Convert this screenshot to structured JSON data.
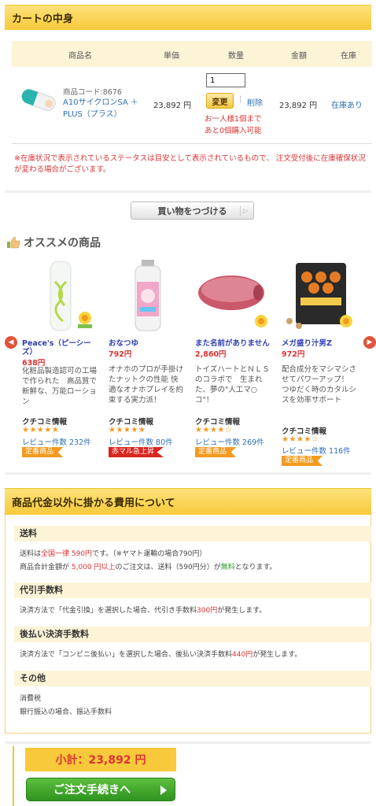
{
  "cart": {
    "title": "カートの中身",
    "columns": [
      "商品名",
      "単価",
      "数量",
      "金額",
      "在庫"
    ],
    "item": {
      "code": "商品コード:8676",
      "name": "A10サイクロンSA ＋ PLUS（プラス）",
      "price": "23,892 円",
      "quantity": "1",
      "change_label": "変更",
      "delete_label": "削除",
      "limit_1": "お一人様1個まで",
      "limit_2": "あと0個購入可能",
      "amount": "23,892 円",
      "stock": "在庫あり"
    },
    "notice": "※在庫状況で表示されているステータスは目安として表示されているもので、 注文受付後に在庫確保状況が変わる場合がございます。",
    "continue_label": "買い物をつづける"
  },
  "recommend": {
    "title": "オススメの商品",
    "items": [
      {
        "name": "Peace's（ピーシーズ）",
        "price": "638円",
        "desc": "化粧品製造認可の工場で作られた　高品質で新鮮な、万能ローション",
        "review_label": "クチコミ情報",
        "stars": "★★★★★",
        "count": "レビュー件数 232件",
        "tag": "定番商品",
        "tag_color": "#f39a1f"
      },
      {
        "name": "おなつゆ",
        "price": "792円",
        "desc": "オナホのプロが手掛けたナットクの性能 快適なオナホプレイを約束する実力派！",
        "review_label": "クチコミ情報",
        "stars": "★★★★★",
        "count": "レビュー件数 80件",
        "tag": "赤マル急上昇",
        "tag_color": "#d8261f"
      },
      {
        "name": "また名前がありません",
        "price": "2,860円",
        "desc": "トイズハートとＮＬＳのコラボで　生まれた、夢の\"人工マ○コ\"！",
        "review_label": "クチコミ情報",
        "stars": "★★★★☆",
        "count": "レビュー件数 269件",
        "tag": "定番商品",
        "tag_color": "#f39a1f"
      },
      {
        "name": "メガ盛り汁男Z",
        "price": "972円",
        "desc": "配合成分をマシマシさせてパワーアップ！　つゆだく時のカタルシスを効率サポート",
        "review_label": "クチコミ情報",
        "stars": "★★★★☆",
        "count": "レビュー件数 116件",
        "tag": "定番商品",
        "tag_color": "#f39a1f"
      }
    ]
  },
  "fees": {
    "title": "商品代金以外に掛かる費用について",
    "shipping_title": "送料",
    "shipping_a": "送料は",
    "shipping_b": "全国一律 590円",
    "shipping_c": "です。（※ヤマト運輸の場合790円）",
    "shipping2_a": "商品合計金額が ",
    "shipping2_b": "5,000 円以上",
    "shipping2_c": "のご注文は、送料（590円分）が",
    "shipping2_d": "無料",
    "shipping2_e": "となります。",
    "cod_title": "代引手数料",
    "cod_a": "決済方法で「代金引換」を選択した場合、代引き手数料",
    "cod_b": "300円",
    "cod_c": "が発生します。",
    "later_title": "後払い決済手数料",
    "later_a": "決済方法で「コンビニ後払い」を選択した場合、後払い決済手数料",
    "later_b": "440円",
    "later_c": "が発生します。",
    "other_title": "その他",
    "other_1": "消費税",
    "other_2": "銀行振込の場合、振込手数料"
  },
  "footer": {
    "subtotal": "小計：23,892 円",
    "order_label": "ご注文手続きへ"
  },
  "colors": {
    "accent": "#f8c93a",
    "link": "#2f6fb4",
    "alert": "#d33333",
    "order": "#3aa82a"
  }
}
